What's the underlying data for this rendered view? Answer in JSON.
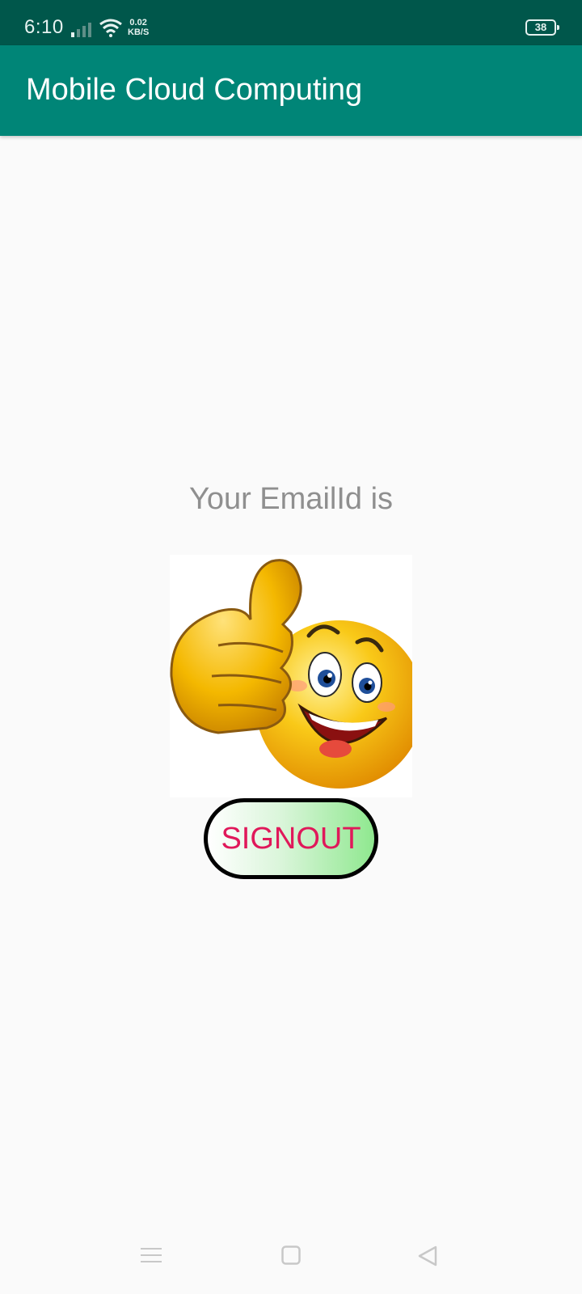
{
  "status_bar": {
    "time": "6:10",
    "net_speed_value": "0.02",
    "net_speed_unit": "KB/S",
    "battery": "38",
    "icons": [
      "signal-icon",
      "wifi-icon",
      "battery-icon"
    ]
  },
  "app_bar": {
    "title": "Mobile Cloud Computing",
    "color": "#008577"
  },
  "main": {
    "email_label": "Your EmailId is",
    "image_description_icon": "thumbs-up-smiley-icon",
    "signout_label": "SIGNOUT",
    "signout_text_color": "#e0185a"
  },
  "nav_bar": {
    "icons": [
      "menu-icon",
      "home-icon",
      "back-icon"
    ]
  },
  "colors": {
    "status_bar": "#00574b",
    "app_bar": "#008577",
    "background": "#fafafa"
  }
}
